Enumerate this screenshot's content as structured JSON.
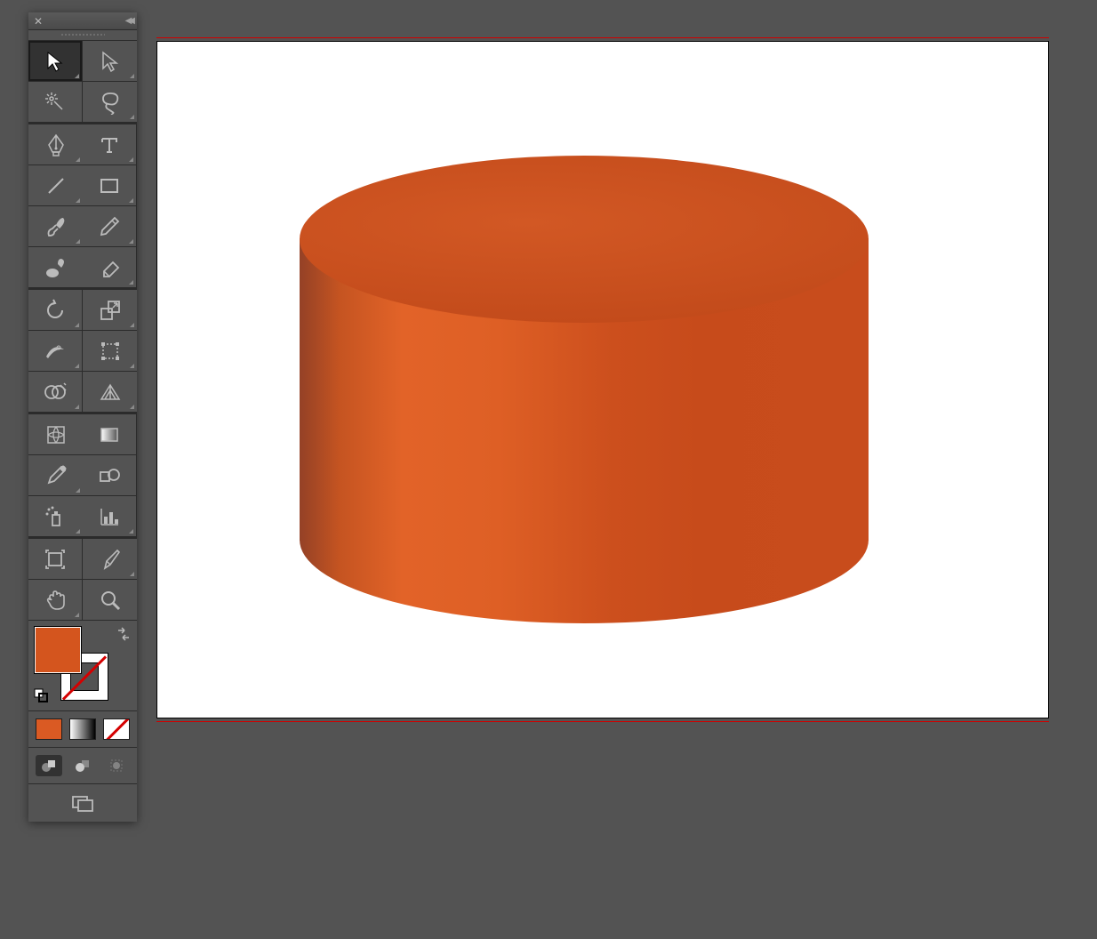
{
  "tools": [
    {
      "name": "selection-tool",
      "selected": true,
      "flyout": true
    },
    {
      "name": "direct-selection-tool",
      "flyout": true
    },
    {
      "name": "magic-wand-tool",
      "flyout": false
    },
    {
      "name": "lasso-tool",
      "flyout": true
    },
    {
      "name": "pen-tool",
      "flyout": true
    },
    {
      "name": "type-tool",
      "flyout": true
    },
    {
      "name": "line-segment-tool",
      "flyout": true
    },
    {
      "name": "rectangle-tool",
      "flyout": true
    },
    {
      "name": "paintbrush-tool",
      "flyout": true
    },
    {
      "name": "pencil-tool",
      "flyout": true
    },
    {
      "name": "blob-brush-tool",
      "flyout": false
    },
    {
      "name": "eraser-tool",
      "flyout": true
    },
    {
      "name": "rotate-tool",
      "flyout": true
    },
    {
      "name": "scale-tool",
      "flyout": true
    },
    {
      "name": "width-tool",
      "flyout": true
    },
    {
      "name": "free-transform-tool",
      "flyout": true
    },
    {
      "name": "shape-builder-tool",
      "flyout": true
    },
    {
      "name": "perspective-grid-tool",
      "flyout": true
    },
    {
      "name": "mesh-tool",
      "flyout": false
    },
    {
      "name": "gradient-tool",
      "flyout": false
    },
    {
      "name": "eyedropper-tool",
      "flyout": true
    },
    {
      "name": "blend-tool",
      "flyout": false
    },
    {
      "name": "symbol-sprayer-tool",
      "flyout": true
    },
    {
      "name": "column-graph-tool",
      "flyout": true
    },
    {
      "name": "artboard-tool",
      "flyout": false
    },
    {
      "name": "slice-tool",
      "flyout": true
    },
    {
      "name": "hand-tool",
      "flyout": true
    },
    {
      "name": "zoom-tool",
      "flyout": false
    }
  ],
  "colors": {
    "fill": "#d4551e",
    "stroke": "none"
  },
  "color_modes": [
    "solid",
    "gradient",
    "none"
  ],
  "draw_modes": [
    {
      "name": "draw-normal",
      "active": true
    },
    {
      "name": "draw-behind",
      "active": false
    },
    {
      "name": "draw-inside",
      "active": false
    }
  ],
  "artwork": {
    "shape": "cylinder",
    "fill_base": "#cc4f1d",
    "fill_highlight": "#e26328",
    "fill_shadow": "#944126"
  }
}
